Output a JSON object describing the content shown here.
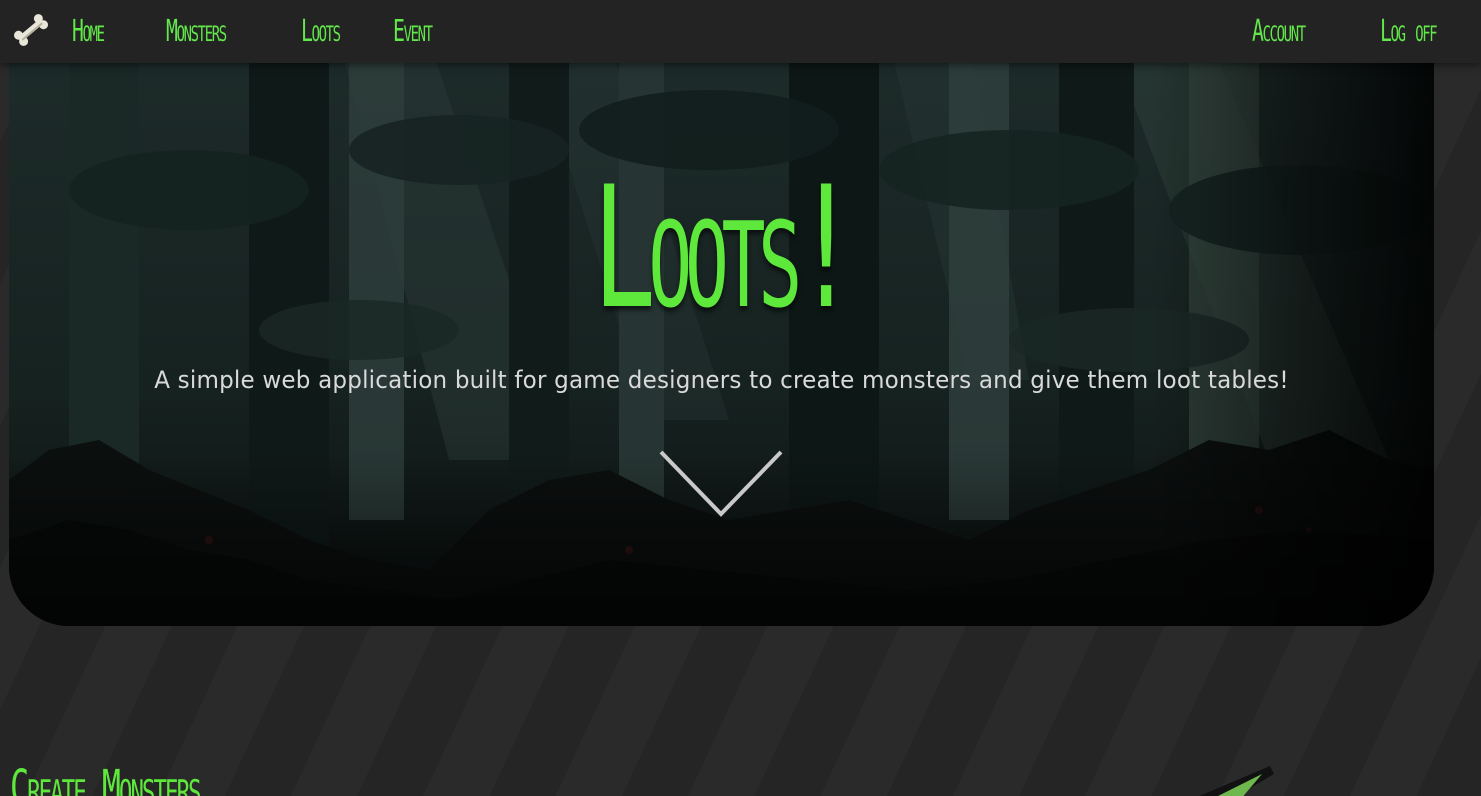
{
  "nav": {
    "logo_icon": "bone-icon",
    "home": "Home",
    "monsters": "Monsters",
    "loots": "Loots",
    "event": "Event",
    "account": "Account",
    "logoff": "Log off"
  },
  "hero": {
    "title": "Loots!",
    "subtitle": "A simple web application built for game designers to create monsters and give them loot tables!",
    "scroll_icon": "chevron-down-icon"
  },
  "section": {
    "heading": "Create Monsters"
  },
  "colors": {
    "accent": "#5ee83c",
    "background": "#262626",
    "navbar": "#232323",
    "subtitle": "#d9d9d9"
  }
}
